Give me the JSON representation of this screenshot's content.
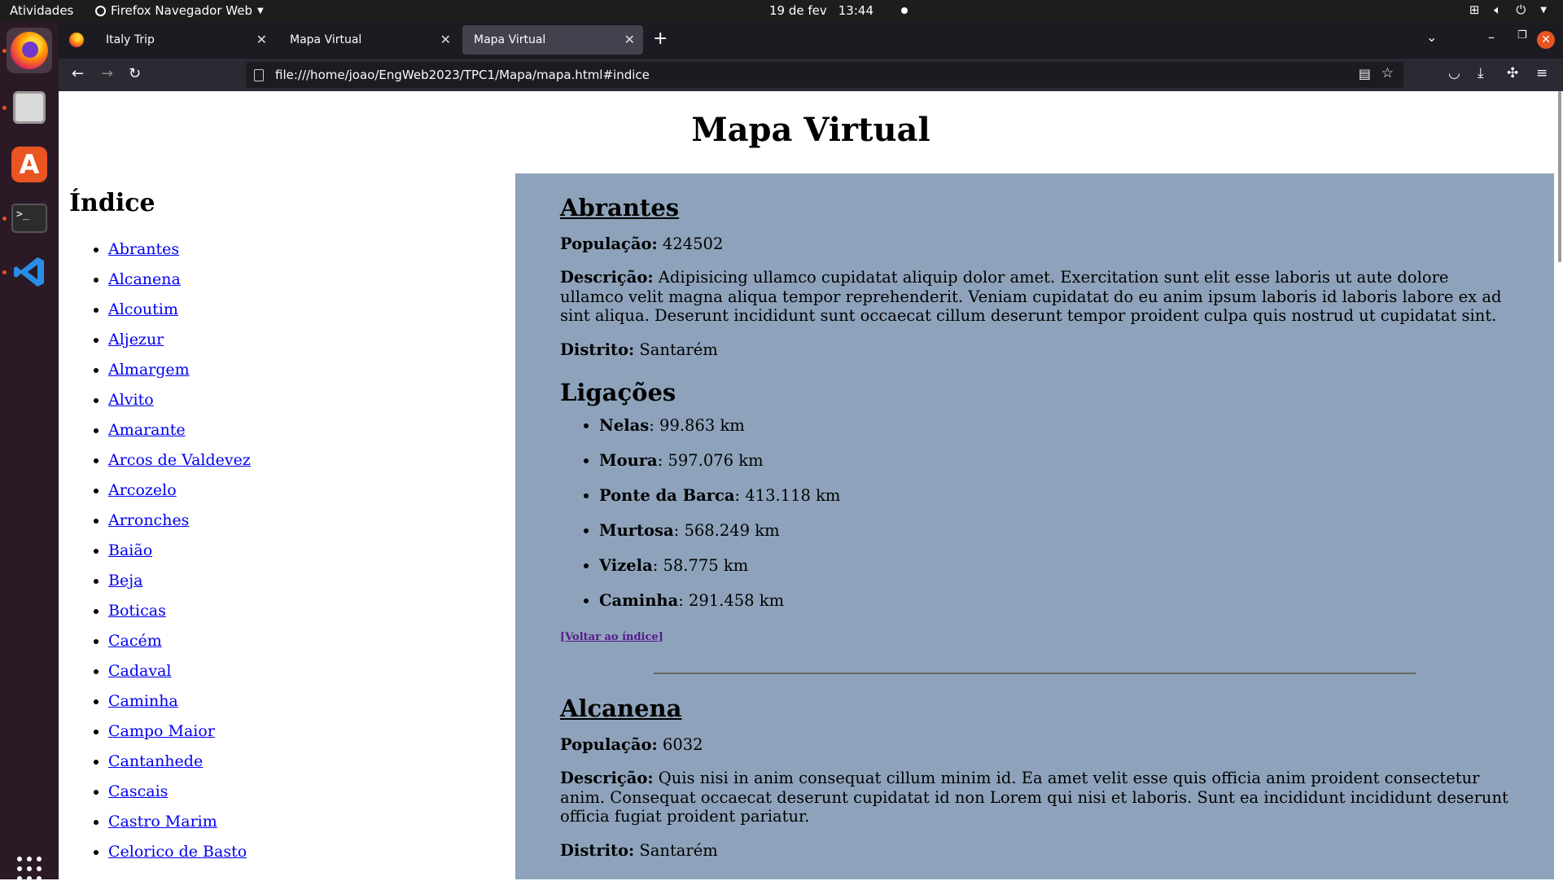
{
  "system": {
    "activities": "Atividades",
    "app_menu": "Firefox Navegador Web",
    "date": "19 de fev",
    "time": "13:44"
  },
  "browser": {
    "tabs": [
      {
        "label": "Italy Trip",
        "selected": false
      },
      {
        "label": "Mapa Virtual",
        "selected": false
      },
      {
        "label": "Mapa Virtual",
        "selected": true
      }
    ],
    "url": "file:///home/joao/EngWeb2023/TPC1/Mapa/mapa.html#indice"
  },
  "page": {
    "title": "Mapa Virtual",
    "index_title": "Índice",
    "index_items": [
      "Abrantes",
      "Alcanena",
      "Alcoutim",
      "Aljezur",
      "Almargem",
      "Alvito",
      "Amarante",
      "Arcos de Valdevez",
      "Arcozelo",
      "Arronches",
      "Baião",
      "Beja",
      "Boticas",
      "Cacém",
      "Cadaval",
      "Caminha",
      "Campo Maior",
      "Cantanhede",
      "Cascais",
      "Castro Marim",
      "Celorico de Basto"
    ],
    "labels": {
      "populacao": "População:",
      "descricao": "Descrição:",
      "distrito": "Distrito:",
      "ligacoes": "Ligações",
      "back": "[Voltar ao índice]"
    },
    "cities": [
      {
        "name": "Abrantes",
        "populacao": "424502",
        "descricao": "Adipisicing ullamco cupidatat aliquip dolor amet. Exercitation sunt elit esse laboris ut aute dolore ullamco velit magna aliqua tempor reprehenderit. Veniam cupidatat do eu anim ipsum laboris id laboris labore ex ad sint aliqua. Deserunt incididunt sunt occaecat cillum deserunt tempor proident culpa quis nostrud ut cupidatat sint.",
        "distrito": "Santarém",
        "ligacoes": [
          {
            "destino": "Nelas",
            "dist": ": 99.863 km"
          },
          {
            "destino": "Moura",
            "dist": ": 597.076 km"
          },
          {
            "destino": "Ponte da Barca",
            "dist": ": 413.118 km"
          },
          {
            "destino": "Murtosa",
            "dist": ": 568.249 km"
          },
          {
            "destino": "Vizela",
            "dist": ": 58.775 km"
          },
          {
            "destino": "Caminha",
            "dist": ": 291.458 km"
          }
        ]
      },
      {
        "name": "Alcanena",
        "populacao": "6032",
        "descricao": "Quis nisi in anim consequat cillum minim id. Ea amet velit esse quis officia anim proident consectetur anim. Consequat occaecat deserunt cupidatat id non Lorem qui nisi et laboris. Sunt ea incididunt incididunt deserunt officia fugiat proident pariatur.",
        "distrito": "Santarém"
      }
    ]
  }
}
